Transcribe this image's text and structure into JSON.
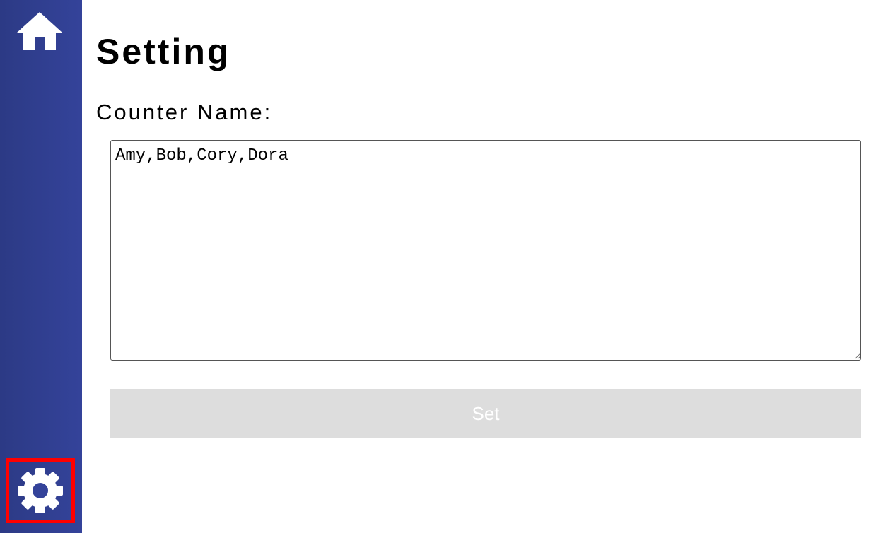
{
  "sidebar": {
    "home_icon": "home-icon",
    "settings_icon": "gear-icon",
    "selected_item": "settings",
    "highlight_color": "#ff0000",
    "background_color": "#34439a"
  },
  "main": {
    "title": "Setting",
    "counter_name_label": "Counter Name:",
    "counter_name_value": "Amy,Bob,Cory,Dora",
    "set_button_label": "Set",
    "set_button_color": "#dddddd"
  }
}
